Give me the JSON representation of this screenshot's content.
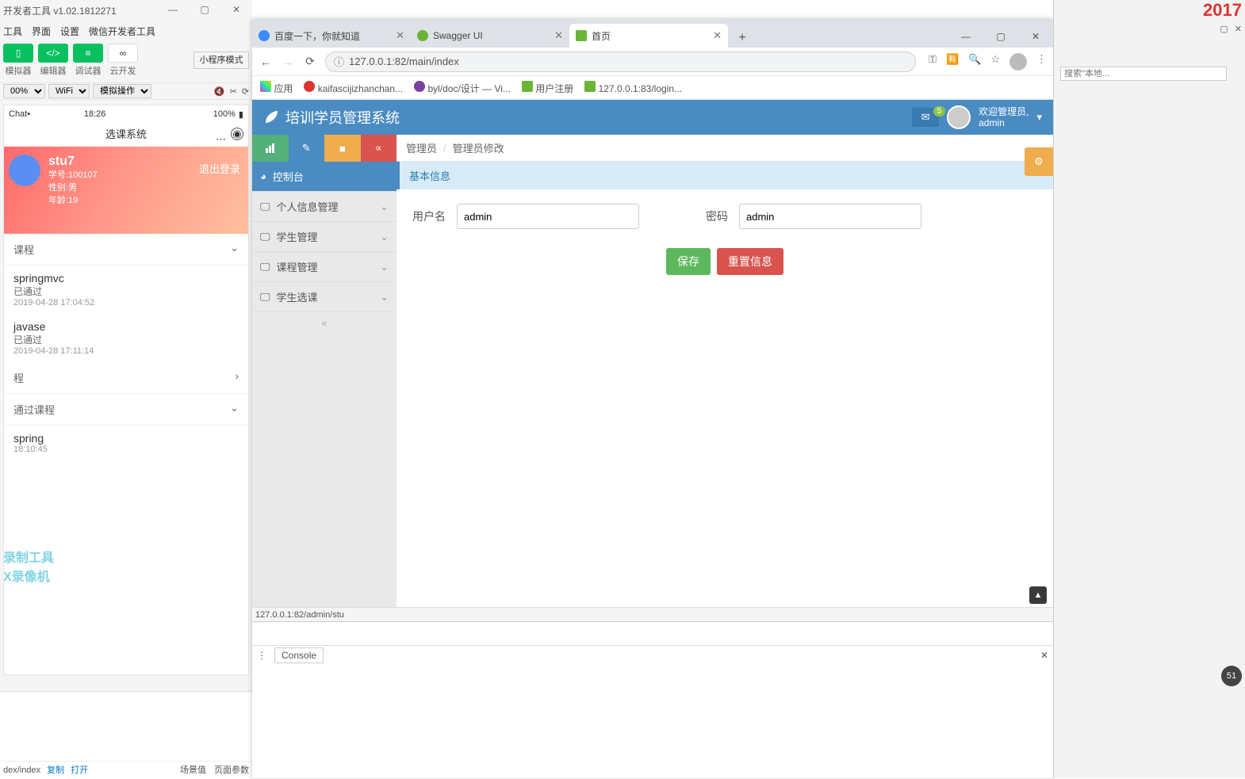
{
  "devtools": {
    "title": "开发者工具 v1.02.1812271",
    "menu": [
      "工具",
      "界面",
      "设置",
      "微信开发者工具"
    ],
    "toolbar": {
      "sim": "模拟器",
      "editor": "编辑器",
      "debugger": "调试器",
      "cloud": "云开发",
      "mode": "小程序模式"
    },
    "opts": {
      "zoom": "00%",
      "net": "WiFi",
      "mock": "模拟操作"
    },
    "sim": {
      "carrier": "Chat▪",
      "time": "18:26",
      "battery": "100%",
      "nav_title": "选课系统",
      "user": {
        "name": "stu7",
        "sid": "学号:100107",
        "gender": "性别:男",
        "age": "年龄:19",
        "logout": "退出登录"
      },
      "sec_mycourse": "课程",
      "courses": [
        {
          "name": "springmvc",
          "status": "已通过",
          "time": "2019-04-28 17:04:52"
        },
        {
          "name": "javase",
          "status": "已通过",
          "time": "2019-04-28 17:11:14"
        }
      ],
      "sec_cheng": "程",
      "sec_passed": "通过课程",
      "passed": {
        "name": "spring",
        "time": "18:10:45"
      }
    },
    "footer": {
      "path": "dex/index",
      "copy": "复制",
      "open": "打开",
      "scene": "场景值",
      "params": "页面参数"
    }
  },
  "chrome": {
    "tabs": [
      {
        "label": "百度一下，你就知道",
        "active": false,
        "icon": "#3b8cff"
      },
      {
        "label": "Swagger UI",
        "active": false,
        "icon": "#6bb536"
      },
      {
        "label": "首页",
        "active": true,
        "icon": "#6bb536"
      }
    ],
    "url": "127.0.0.1:82/main/index",
    "bookmarks": [
      {
        "icon": "#f2b01e",
        "label": "应用"
      },
      {
        "icon": "#d33",
        "label": "kaifascijizhanchan..."
      },
      {
        "icon": "#7b3fa0",
        "label": "byl/doc/设计 — Vi..."
      },
      {
        "icon": "#6bb536",
        "label": "用户注册"
      },
      {
        "icon": "#6bb536",
        "label": "127.0.0.1:83/login..."
      }
    ],
    "status_url": "127.0.0.1:82/admin/stu",
    "console_tab": "Console"
  },
  "page": {
    "brand": "培训学员管理系统",
    "mail_count": "5",
    "welcome_l1": "欢迎管理员,",
    "welcome_l2": "admin",
    "sidebar": [
      {
        "label": "控制台",
        "active": true,
        "chev": false
      },
      {
        "label": "个人信息管理",
        "active": false,
        "chev": true
      },
      {
        "label": "学生管理",
        "active": false,
        "chev": true
      },
      {
        "label": "课程管理",
        "active": false,
        "chev": true
      },
      {
        "label": "学生选课",
        "active": false,
        "chev": true
      }
    ],
    "breadcrumb": [
      "管理员",
      "管理员修改"
    ],
    "panel_title": "基本信息",
    "form": {
      "user_label": "用户名",
      "user_value": "admin",
      "pass_label": "密码",
      "pass_value": "admin",
      "save": "保存",
      "reset": "重置信息"
    }
  },
  "ide": {
    "year": "2017",
    "search_ph": "搜索\"本地..."
  }
}
